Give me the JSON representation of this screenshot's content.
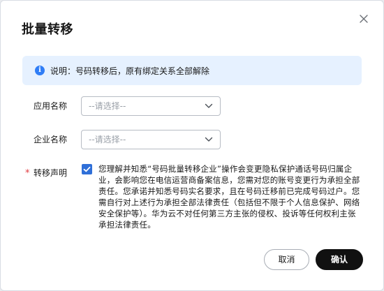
{
  "dialog": {
    "title": "批量转移",
    "close_icon": "close-icon"
  },
  "alert": {
    "icon": "info-icon",
    "icon_glyph": "i",
    "text": "说明：号码转移后，原有绑定关系全部解除",
    "color": "#2f7df6"
  },
  "form": {
    "app_name": {
      "label": "应用名称",
      "placeholder": "--请选择--"
    },
    "company_name": {
      "label": "企业名称",
      "placeholder": "--请选择--"
    },
    "statement": {
      "required_mark": "*",
      "label": "转移声明",
      "checked": true,
      "text": "您理解并知悉“号码批量转移企业”操作会变更隐私保护通话号码归属企业，会影响您在电信运营商备案信息，您需对您的账号变更行为承担全部责任。您承诺并知悉号码实名要求，且在号码迁移前已完成号码过户。您需自行对上述行为承担全部法律责任（包括但不限于个人信息保护、网络安全保护等）。华为云不对任何第三方主张的侵权、投诉等任何权利主张承担法律责任。"
    }
  },
  "footer": {
    "cancel_label": "取消",
    "confirm_label": "确认"
  }
}
